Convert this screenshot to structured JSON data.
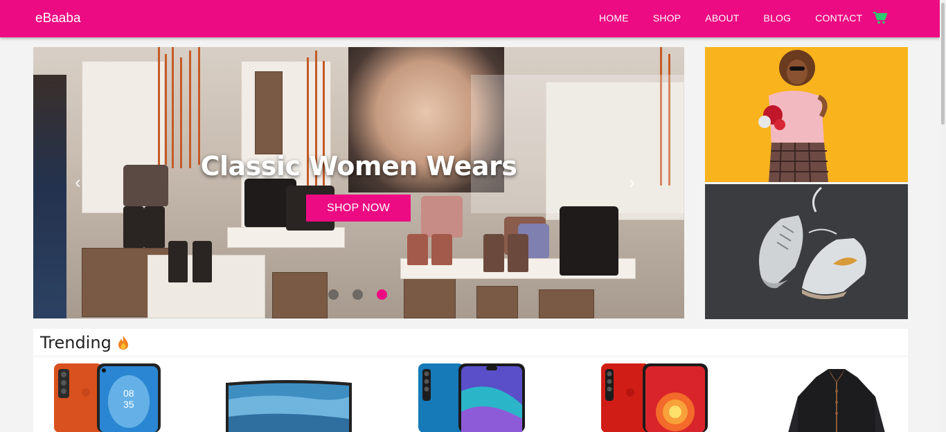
{
  "brand": "eBaaba",
  "nav": {
    "items": [
      "HOME",
      "SHOP",
      "ABOUT",
      "BLOG",
      "CONTACT"
    ],
    "cart_icon": "cart-icon"
  },
  "hero": {
    "headline": "Classic Women Wears",
    "cta": "SHOP NOW",
    "slides": 3,
    "active_slide": 3
  },
  "trending": {
    "title": "Trending",
    "icon": "fire-icon"
  },
  "colors": {
    "accent": "#ec0b82",
    "cart": "#2ecc71"
  }
}
